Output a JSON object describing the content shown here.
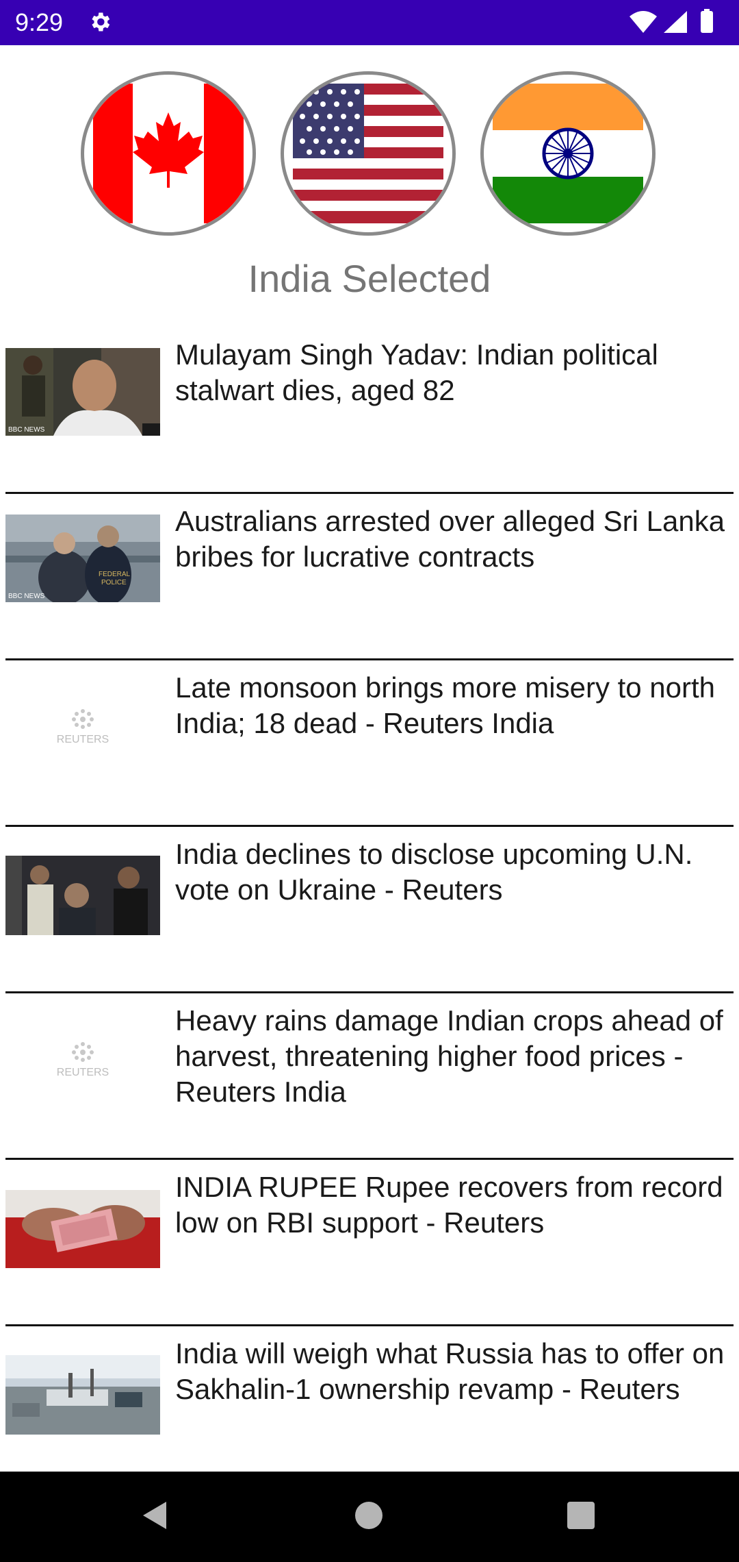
{
  "status_bar": {
    "time": "9:29",
    "background": "#3700b3"
  },
  "flags": [
    {
      "name": "Canada",
      "icon": "canada-flag-icon"
    },
    {
      "name": "United States",
      "icon": "usa-flag-icon"
    },
    {
      "name": "India",
      "icon": "india-flag-icon"
    }
  ],
  "selected_label": "India Selected",
  "news": [
    {
      "headline": "Mulayam Singh Yadav: Indian political stalwart dies, aged 82",
      "thumb": "bbc-photo",
      "watermark": "BBC NEWS"
    },
    {
      "headline": "Australians arrested over alleged Sri Lanka bribes for lucrative contracts",
      "thumb": "bbc-photo",
      "watermark": "BBC NEWS"
    },
    {
      "headline": "Late monsoon brings more misery to north India; 18 dead - Reuters India",
      "thumb": "reuters-logo",
      "watermark": "REUTERS"
    },
    {
      "headline": "India declines to disclose upcoming U.N. vote on Ukraine - Reuters",
      "thumb": "photo"
    },
    {
      "headline": "Heavy rains damage Indian crops ahead of harvest, threatening higher food prices - Reuters India",
      "thumb": "reuters-logo",
      "watermark": "REUTERS"
    },
    {
      "headline": "INDIA RUPEE Rupee recovers from record low on RBI support - Reuters",
      "thumb": "photo"
    },
    {
      "headline": "India will weigh what Russia has to offer on Sakhalin-1 ownership revamp - Reuters",
      "thumb": "photo"
    }
  ],
  "nav": {
    "back": "back-icon",
    "home": "home-icon",
    "recents": "recents-icon"
  }
}
